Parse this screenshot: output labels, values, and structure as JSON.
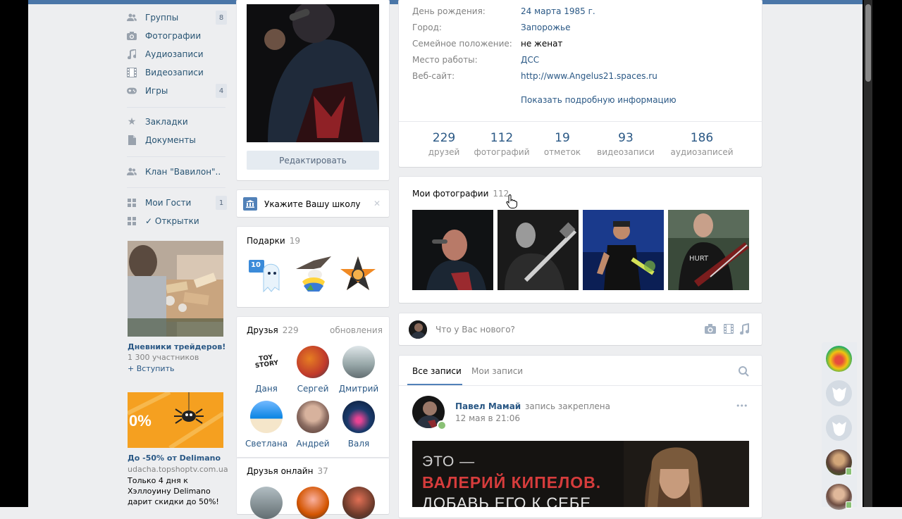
{
  "menu": [
    {
      "icon": "people-icon",
      "label": "Группы",
      "count": "8"
    },
    {
      "icon": "camera-icon",
      "label": "Фотографии",
      "count": ""
    },
    {
      "icon": "music-icon",
      "label": "Аудиозаписи",
      "count": ""
    },
    {
      "icon": "film-icon",
      "label": "Видеозаписи",
      "count": ""
    },
    {
      "icon": "gamepad-icon",
      "label": "Игры",
      "count": "4"
    },
    {
      "icon": "star-icon",
      "label": "Закладки",
      "count": ""
    },
    {
      "icon": "document-icon",
      "label": "Документы",
      "count": ""
    },
    {
      "icon": "people-icon",
      "label": "Клан \"Вавилон\"..",
      "count": ""
    },
    {
      "icon": "apps-icon",
      "label": "Мои Гости",
      "count": "1"
    },
    {
      "icon": "apps-icon",
      "label": "✓ Открытки",
      "count": ""
    }
  ],
  "ad1": {
    "title": "Дневники трейдеров!",
    "subtitle": "1 300 участников",
    "action": "+ Вступить"
  },
  "ad2": {
    "title": "До -50% от Delimano",
    "domain": "udacha.topshoptv.com.ua",
    "text": "Только 4 дня к Хэллоуину Delimano дарит скидки до 50%!",
    "img_text": "0%"
  },
  "profile": {
    "edit_button": "Редактировать"
  },
  "school": {
    "label": "Укажите Вашу школу",
    "close": "✕"
  },
  "gifts": {
    "title": "Подарки",
    "count": "19",
    "badge": "10"
  },
  "friends": {
    "title": "Друзья",
    "count": "229",
    "updates": "обновления",
    "items": [
      {
        "name": "Даня",
        "color": "#ffffff",
        "tag": "TOY STORY"
      },
      {
        "name": "Сергей",
        "color": "#c0392b"
      },
      {
        "name": "Дмитрий",
        "color": "#7f8c8d"
      },
      {
        "name": "Светлана",
        "color": "#3498db"
      },
      {
        "name": "Андрей",
        "color": "#8d6e63"
      },
      {
        "name": "Валя",
        "color": "#1a3a6b"
      }
    ]
  },
  "friends_online": {
    "title": "Друзья онлайн",
    "count": "37"
  },
  "info": [
    {
      "label": "День рождения:",
      "value": "24 марта 1985 г.",
      "link": true
    },
    {
      "label": "Город:",
      "value": "Запорожье",
      "link": true
    },
    {
      "label": "Семейное положение:",
      "value": "не женат",
      "link": false
    },
    {
      "label": "Место работы:",
      "value": "ДСС",
      "link": true
    },
    {
      "label": "Веб-сайт:",
      "value": "http://www.Angelus21.spaces.ru",
      "link": true
    }
  ],
  "show_more": "Показать подробную информацию",
  "stats": [
    {
      "num": "229",
      "label": "друзей"
    },
    {
      "num": "112",
      "label": "фотографий"
    },
    {
      "num": "19",
      "label": "отметок"
    },
    {
      "num": "93",
      "label": "видеозаписи"
    },
    {
      "num": "186",
      "label": "аудиозаписей"
    }
  ],
  "photos": {
    "title": "Мои фотографии",
    "count": "112"
  },
  "composer": {
    "placeholder": "Что у Вас нового?"
  },
  "wall": {
    "tab_all": "Все записи",
    "tab_mine": "Мои записи"
  },
  "post": {
    "author": "Павел Мамай",
    "note": "запись закреплена",
    "date": "12 мая в 21:06",
    "more": "•••",
    "banner_line1": "ЭТО —",
    "banner_line2": "ВАЛЕРИЙ КИПЕЛОВ.",
    "banner_line3": "ДОБАВЬ ЕГО К СЕБЕ"
  },
  "colors": {
    "link": "#2a5885",
    "accent": "#4a76a8",
    "banner_red": "#d63c3c"
  }
}
